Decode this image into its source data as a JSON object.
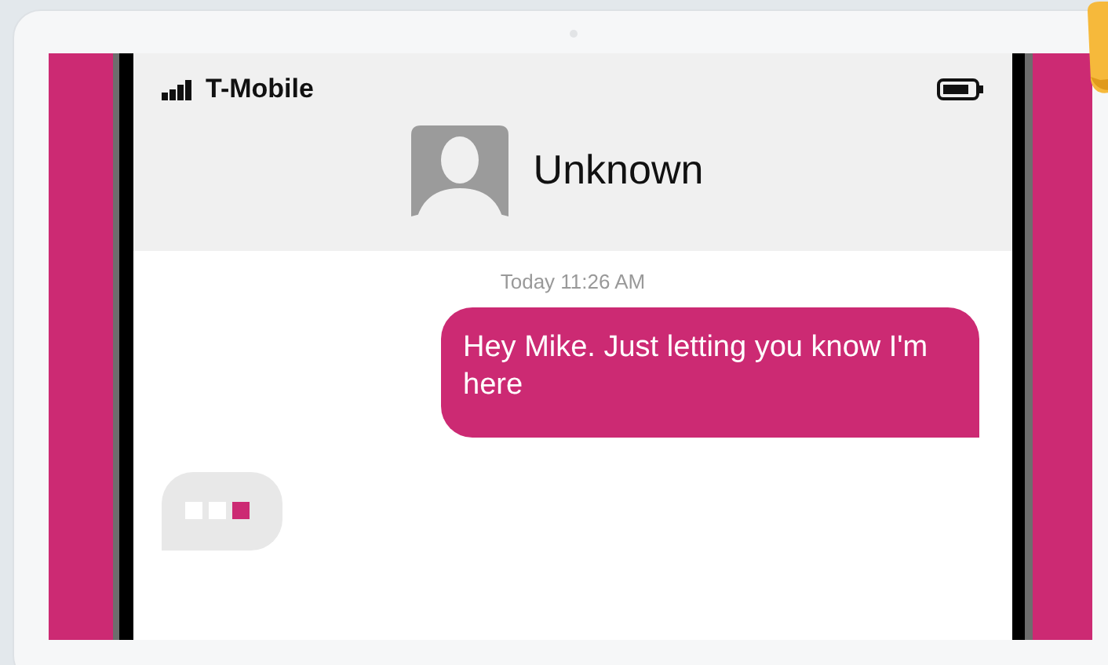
{
  "status_bar": {
    "carrier": "T-Mobile"
  },
  "contact": {
    "name": "Unknown"
  },
  "conversation": {
    "timestamp": "Today 11:26 AM",
    "messages": [
      {
        "kind": "sent",
        "text": "Hey Mike. Just letting you know I'm here"
      }
    ],
    "typing_indicator": {
      "dots": [
        {
          "on": false
        },
        {
          "on": false
        },
        {
          "on": true
        }
      ]
    }
  }
}
